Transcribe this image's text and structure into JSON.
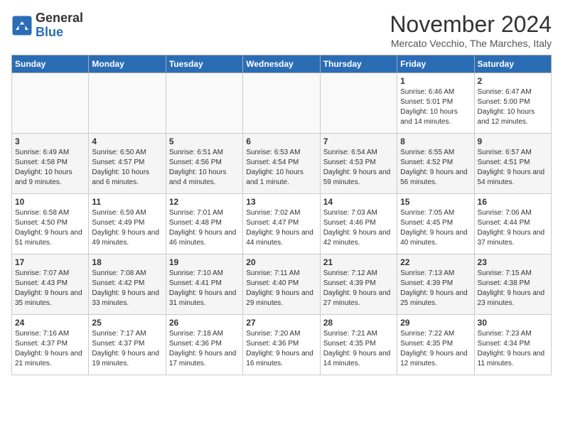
{
  "logo": {
    "general": "General",
    "blue": "Blue"
  },
  "title": "November 2024",
  "location": "Mercato Vecchio, The Marches, Italy",
  "weekdays": [
    "Sunday",
    "Monday",
    "Tuesday",
    "Wednesday",
    "Thursday",
    "Friday",
    "Saturday"
  ],
  "weeks": [
    [
      {
        "day": "",
        "info": ""
      },
      {
        "day": "",
        "info": ""
      },
      {
        "day": "",
        "info": ""
      },
      {
        "day": "",
        "info": ""
      },
      {
        "day": "",
        "info": ""
      },
      {
        "day": "1",
        "info": "Sunrise: 6:46 AM\nSunset: 5:01 PM\nDaylight: 10 hours and 14 minutes."
      },
      {
        "day": "2",
        "info": "Sunrise: 6:47 AM\nSunset: 5:00 PM\nDaylight: 10 hours and 12 minutes."
      }
    ],
    [
      {
        "day": "3",
        "info": "Sunrise: 6:49 AM\nSunset: 4:58 PM\nDaylight: 10 hours and 9 minutes."
      },
      {
        "day": "4",
        "info": "Sunrise: 6:50 AM\nSunset: 4:57 PM\nDaylight: 10 hours and 6 minutes."
      },
      {
        "day": "5",
        "info": "Sunrise: 6:51 AM\nSunset: 4:56 PM\nDaylight: 10 hours and 4 minutes."
      },
      {
        "day": "6",
        "info": "Sunrise: 6:53 AM\nSunset: 4:54 PM\nDaylight: 10 hours and 1 minute."
      },
      {
        "day": "7",
        "info": "Sunrise: 6:54 AM\nSunset: 4:53 PM\nDaylight: 9 hours and 59 minutes."
      },
      {
        "day": "8",
        "info": "Sunrise: 6:55 AM\nSunset: 4:52 PM\nDaylight: 9 hours and 56 minutes."
      },
      {
        "day": "9",
        "info": "Sunrise: 6:57 AM\nSunset: 4:51 PM\nDaylight: 9 hours and 54 minutes."
      }
    ],
    [
      {
        "day": "10",
        "info": "Sunrise: 6:58 AM\nSunset: 4:50 PM\nDaylight: 9 hours and 51 minutes."
      },
      {
        "day": "11",
        "info": "Sunrise: 6:59 AM\nSunset: 4:49 PM\nDaylight: 9 hours and 49 minutes."
      },
      {
        "day": "12",
        "info": "Sunrise: 7:01 AM\nSunset: 4:48 PM\nDaylight: 9 hours and 46 minutes."
      },
      {
        "day": "13",
        "info": "Sunrise: 7:02 AM\nSunset: 4:47 PM\nDaylight: 9 hours and 44 minutes."
      },
      {
        "day": "14",
        "info": "Sunrise: 7:03 AM\nSunset: 4:46 PM\nDaylight: 9 hours and 42 minutes."
      },
      {
        "day": "15",
        "info": "Sunrise: 7:05 AM\nSunset: 4:45 PM\nDaylight: 9 hours and 40 minutes."
      },
      {
        "day": "16",
        "info": "Sunrise: 7:06 AM\nSunset: 4:44 PM\nDaylight: 9 hours and 37 minutes."
      }
    ],
    [
      {
        "day": "17",
        "info": "Sunrise: 7:07 AM\nSunset: 4:43 PM\nDaylight: 9 hours and 35 minutes."
      },
      {
        "day": "18",
        "info": "Sunrise: 7:08 AM\nSunset: 4:42 PM\nDaylight: 9 hours and 33 minutes."
      },
      {
        "day": "19",
        "info": "Sunrise: 7:10 AM\nSunset: 4:41 PM\nDaylight: 9 hours and 31 minutes."
      },
      {
        "day": "20",
        "info": "Sunrise: 7:11 AM\nSunset: 4:40 PM\nDaylight: 9 hours and 29 minutes."
      },
      {
        "day": "21",
        "info": "Sunrise: 7:12 AM\nSunset: 4:39 PM\nDaylight: 9 hours and 27 minutes."
      },
      {
        "day": "22",
        "info": "Sunrise: 7:13 AM\nSunset: 4:39 PM\nDaylight: 9 hours and 25 minutes."
      },
      {
        "day": "23",
        "info": "Sunrise: 7:15 AM\nSunset: 4:38 PM\nDaylight: 9 hours and 23 minutes."
      }
    ],
    [
      {
        "day": "24",
        "info": "Sunrise: 7:16 AM\nSunset: 4:37 PM\nDaylight: 9 hours and 21 minutes."
      },
      {
        "day": "25",
        "info": "Sunrise: 7:17 AM\nSunset: 4:37 PM\nDaylight: 9 hours and 19 minutes."
      },
      {
        "day": "26",
        "info": "Sunrise: 7:18 AM\nSunset: 4:36 PM\nDaylight: 9 hours and 17 minutes."
      },
      {
        "day": "27",
        "info": "Sunrise: 7:20 AM\nSunset: 4:36 PM\nDaylight: 9 hours and 16 minutes."
      },
      {
        "day": "28",
        "info": "Sunrise: 7:21 AM\nSunset: 4:35 PM\nDaylight: 9 hours and 14 minutes."
      },
      {
        "day": "29",
        "info": "Sunrise: 7:22 AM\nSunset: 4:35 PM\nDaylight: 9 hours and 12 minutes."
      },
      {
        "day": "30",
        "info": "Sunrise: 7:23 AM\nSunset: 4:34 PM\nDaylight: 9 hours and 11 minutes."
      }
    ]
  ]
}
